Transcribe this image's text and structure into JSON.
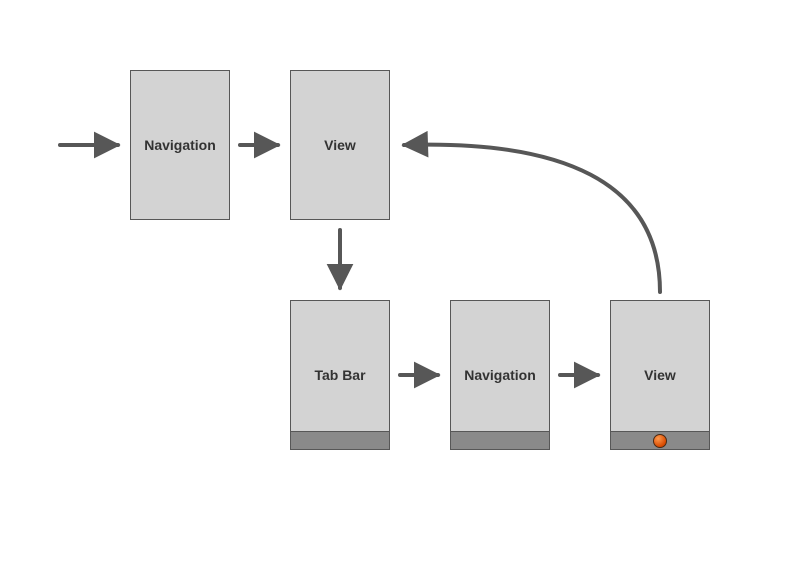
{
  "nodes": {
    "nav1": {
      "label": "Navigation"
    },
    "view1": {
      "label": "View"
    },
    "tabbar": {
      "label": "Tab Bar"
    },
    "nav2": {
      "label": "Navigation"
    },
    "view2": {
      "label": "View"
    }
  },
  "diagram": {
    "description": "Flow diagram of navigation controller hierarchy with a tab bar interface",
    "edges": [
      {
        "from": "entry",
        "to": "nav1"
      },
      {
        "from": "nav1",
        "to": "view1"
      },
      {
        "from": "view1",
        "to": "tabbar"
      },
      {
        "from": "tabbar",
        "to": "nav2"
      },
      {
        "from": "nav2",
        "to": "view2"
      },
      {
        "from": "view2",
        "to": "view1",
        "curved": true
      }
    ],
    "tabbar_nodes": [
      "tabbar",
      "nav2",
      "view2"
    ],
    "selected_tab_node": "view2"
  }
}
